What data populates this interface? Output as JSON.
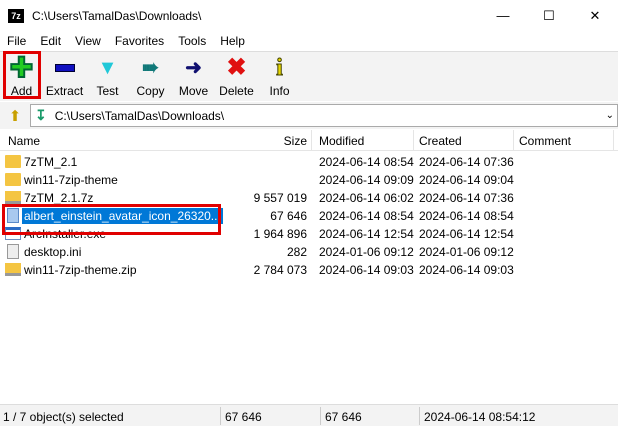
{
  "window": {
    "title": "C:\\Users\\TamalDas\\Downloads\\",
    "app_icon": "7z"
  },
  "menu": [
    "File",
    "Edit",
    "View",
    "Favorites",
    "Tools",
    "Help"
  ],
  "toolbar": [
    {
      "label": "Add",
      "icon": "plus-icon",
      "color": "#22cc22"
    },
    {
      "label": "Extract",
      "icon": "minus-icon",
      "color": "#1010c0"
    },
    {
      "label": "Test",
      "icon": "check-icon",
      "color": "#20c8d8"
    },
    {
      "label": "Copy",
      "icon": "copy-arrow-icon",
      "color": "#107878"
    },
    {
      "label": "Move",
      "icon": "move-arrow-icon",
      "color": "#101070"
    },
    {
      "label": "Delete",
      "icon": "delete-x-icon",
      "color": "#e01010"
    },
    {
      "label": "Info",
      "icon": "info-icon",
      "color": "#e8d800"
    }
  ],
  "address": {
    "path": "C:\\Users\\TamalDas\\Downloads\\"
  },
  "columns": {
    "name": "Name",
    "size": "Size",
    "modified": "Modified",
    "created": "Created",
    "comment": "Comment"
  },
  "files": [
    {
      "name": "7zTM_2.1",
      "size": "",
      "modified": "2024-06-14 08:54",
      "created": "2024-06-14 07:36",
      "type": "folder"
    },
    {
      "name": "win11-7zip-theme",
      "size": "",
      "modified": "2024-06-14 09:09",
      "created": "2024-06-14 09:04",
      "type": "folder"
    },
    {
      "name": "7zTM_2.1.7z",
      "size": "9 557 019",
      "modified": "2024-06-14 06:02",
      "created": "2024-06-14 07:36",
      "type": "archive"
    },
    {
      "name": "albert_einstein_avatar_icon_26320...",
      "size": "67 646",
      "modified": "2024-06-14 08:54",
      "created": "2024-06-14 08:54",
      "type": "doc",
      "selected": true
    },
    {
      "name": "ArcInstaller.exe",
      "size": "1 964 896",
      "modified": "2024-06-14 12:54",
      "created": "2024-06-14 12:54",
      "type": "exe"
    },
    {
      "name": "desktop.ini",
      "size": "282",
      "modified": "2024-01-06 09:12",
      "created": "2024-01-06 09:12",
      "type": "ini"
    },
    {
      "name": "win11-7zip-theme.zip",
      "size": "2 784 073",
      "modified": "2024-06-14 09:03",
      "created": "2024-06-14 09:03",
      "type": "archive"
    }
  ],
  "status": {
    "selection": "1 / 7 object(s) selected",
    "size": "67 646",
    "packed": "67 646",
    "modified": "2024-06-14 08:54:12"
  }
}
